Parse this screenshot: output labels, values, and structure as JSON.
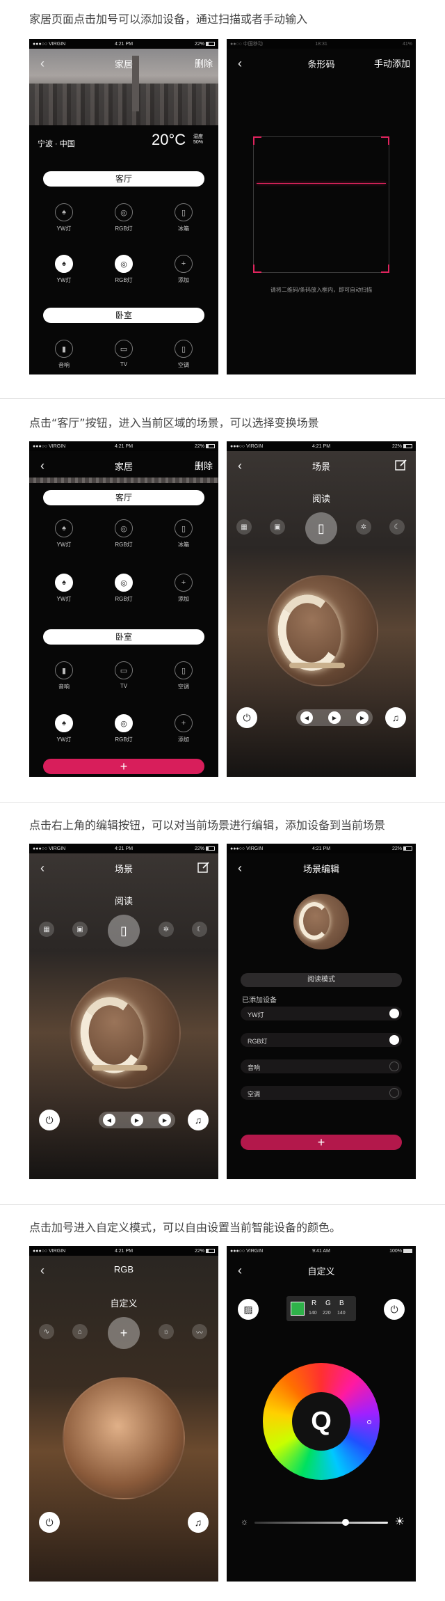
{
  "captions": {
    "c1": "家居页面点击加号可以添加设备，通过扫描或者手动输入",
    "c2": "点击“客厅”按钮，进入当前区域的场景，可以选择变换场景",
    "c3": "点击右上角的编辑按钮，可以对当前场景进行编辑，添加设备到当前场景",
    "c4": "点击加号进入自定义模式，可以自由设置当前智能设备的颜色。"
  },
  "status": {
    "carrier": "●●●○○ VIRGIN",
    "time": "4:21 PM",
    "battery": "22%",
    "carrier2": "●●○○ 中国移动",
    "time2": "18:31",
    "battery2": "41%",
    "time3": "9:41 AM",
    "battery3": "100%"
  },
  "home": {
    "title": "家居",
    "delete": "删除",
    "city": "宁波 · 中国",
    "temp": "20°C",
    "weather_label": "湿度",
    "humidity": "50%",
    "room1": "客厅",
    "room2": "卧室",
    "devices_row1": [
      {
        "label": "YW灯",
        "icon": "lamp-icon"
      },
      {
        "label": "RGB灯",
        "icon": "bulb-icon"
      },
      {
        "label": "冰箱",
        "icon": "fridge-icon"
      }
    ],
    "devices_row2": [
      {
        "label": "YW灯",
        "icon": "lamp-icon"
      },
      {
        "label": "RGB灯",
        "icon": "bulb-icon"
      },
      {
        "label": "添加",
        "icon": "plus-icon"
      }
    ],
    "devices_row3": [
      {
        "label": "音响",
        "icon": "speaker-icon"
      },
      {
        "label": "TV",
        "icon": "tv-icon"
      },
      {
        "label": "空调",
        "icon": "ac-icon"
      }
    ],
    "devices_row4": [
      {
        "label": "YW灯",
        "icon": "lamp-icon"
      },
      {
        "label": "RGB灯",
        "icon": "bulb-icon"
      },
      {
        "label": "添加",
        "icon": "plus-icon"
      }
    ],
    "add": "+"
  },
  "scan": {
    "title": "条形码",
    "manual": "手动添加",
    "hint": "请将二维码/条码放入框内，即可自动扫描"
  },
  "scene": {
    "title": "场景",
    "mode": "阅读"
  },
  "scene_edit": {
    "title": "场景编辑",
    "mode": "阅读模式",
    "added": "已添加设备",
    "devices": [
      {
        "name": "YW灯",
        "on": true
      },
      {
        "name": "RGB灯",
        "on": true
      },
      {
        "name": "音响",
        "on": false
      },
      {
        "name": "空调",
        "on": false
      }
    ],
    "add": "+"
  },
  "rgb": {
    "title": "RGB",
    "mode": "自定义"
  },
  "custom": {
    "title": "自定义",
    "r_label": "R",
    "g_label": "G",
    "b_label": "B",
    "r": "140",
    "g": "220",
    "b": "140",
    "swatch": "#2fb24a",
    "brightness": 0.68
  }
}
